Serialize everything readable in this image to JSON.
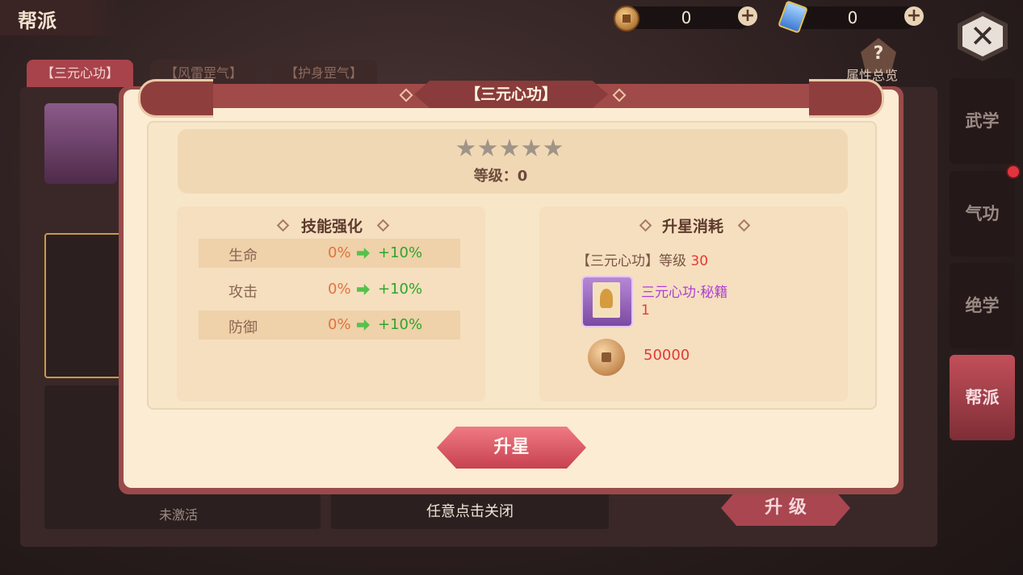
{
  "topbar": {
    "title": "帮派",
    "coin": {
      "value": "0"
    },
    "gem": {
      "value": "0"
    }
  },
  "background": {
    "tabs": [
      "【三元心功】",
      "【风雷罡气】",
      "【护身罡气】"
    ],
    "help_label": "属性总览",
    "inactive_label": "未激活",
    "upgrade_button": "升 级",
    "dismiss_hint": "任意点击关闭"
  },
  "side_tabs": [
    {
      "label": "武学",
      "active": false
    },
    {
      "label": "气功",
      "active": false
    },
    {
      "label": "绝学",
      "active": false
    },
    {
      "label": "帮派",
      "active": true
    }
  ],
  "modal": {
    "title": "【三元心功】",
    "stars_total": 5,
    "stars_filled": 0,
    "level_label": "等级：0",
    "skill": {
      "title": "技能强化",
      "rows": [
        {
          "label": "生命",
          "current": "0%",
          "next": "+10%"
        },
        {
          "label": "攻击",
          "current": "0%",
          "next": "+10%"
        },
        {
          "label": "防御",
          "current": "0%",
          "next": "+10%"
        }
      ]
    },
    "cost": {
      "title": "升星消耗",
      "requirement_text": "【三元心功】等级",
      "requirement_level": "30",
      "item_name": "三元心功·秘籍",
      "item_count": "1",
      "coin_amount": "50000"
    },
    "upstar_button": "升星"
  },
  "colors": {
    "accent_red": "#c7414f",
    "cost_red": "#e23a37",
    "bonus_green": "#2ea52a",
    "item_purple": "#b03ed8",
    "modal_bg": "#fbecd3"
  }
}
